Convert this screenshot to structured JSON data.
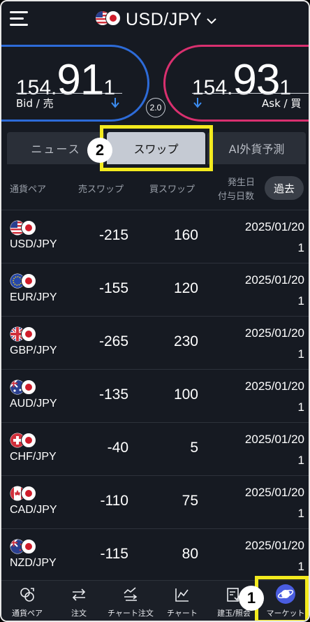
{
  "header": {
    "pair_title": "USD/JPY",
    "menu_icon": "hamburger-menu-icon",
    "dropdown_icon": "chevron-down-icon"
  },
  "quotes": {
    "bid": {
      "prefix": "154.",
      "big": "91",
      "last": "1",
      "label": "Bid / 売",
      "color": "#2d6bd8",
      "direction": "down"
    },
    "ask": {
      "prefix": "154.",
      "big": "93",
      "last": "1",
      "label": "Ask / 買",
      "color": "#d9306f",
      "direction": "down"
    },
    "spread": "2.0"
  },
  "tabs": [
    {
      "label": "ニュース",
      "active": false
    },
    {
      "label": "スワップ",
      "active": true
    },
    {
      "label": "AI外貨予測",
      "active": false
    }
  ],
  "annotations": {
    "badge_1": "1",
    "badge_2": "2",
    "highlight_color": "#f3ea1e"
  },
  "table": {
    "headers": {
      "pair": "通貨ペア",
      "sell": "売スワップ",
      "buy": "買スワップ",
      "date_line1": "発生日",
      "date_line2": "付与日数"
    },
    "past_button": "過去",
    "rows": [
      {
        "pair": "USD/JPY",
        "flag": "us",
        "sell": "-215",
        "buy": "160",
        "date": "2025/01/20",
        "days": "1"
      },
      {
        "pair": "EUR/JPY",
        "flag": "eu",
        "sell": "-155",
        "buy": "120",
        "date": "2025/01/20",
        "days": "1"
      },
      {
        "pair": "GBP/JPY",
        "flag": "gb",
        "sell": "-265",
        "buy": "230",
        "date": "2025/01/20",
        "days": "1"
      },
      {
        "pair": "AUD/JPY",
        "flag": "au",
        "sell": "-135",
        "buy": "100",
        "date": "2025/01/20",
        "days": "1"
      },
      {
        "pair": "CHF/JPY",
        "flag": "ch",
        "sell": "-40",
        "buy": "5",
        "date": "2025/01/20",
        "days": "1"
      },
      {
        "pair": "CAD/JPY",
        "flag": "ca",
        "sell": "-110",
        "buy": "75",
        "date": "2025/01/20",
        "days": "1"
      },
      {
        "pair": "NZD/JPY",
        "flag": "nz",
        "sell": "-115",
        "buy": "80",
        "date": "2025/01/20",
        "days": "1"
      }
    ]
  },
  "bottom_nav": [
    {
      "label": "通貨ペア",
      "icon": "currency-pair-icon"
    },
    {
      "label": "注文",
      "icon": "order-arrows-icon"
    },
    {
      "label": "チャート注文",
      "icon": "chart-order-icon"
    },
    {
      "label": "チャート",
      "icon": "line-chart-icon"
    },
    {
      "label": "建玉/照会",
      "icon": "position-inquiry-icon"
    },
    {
      "label": "マーケット",
      "icon": "market-planet-icon"
    }
  ]
}
